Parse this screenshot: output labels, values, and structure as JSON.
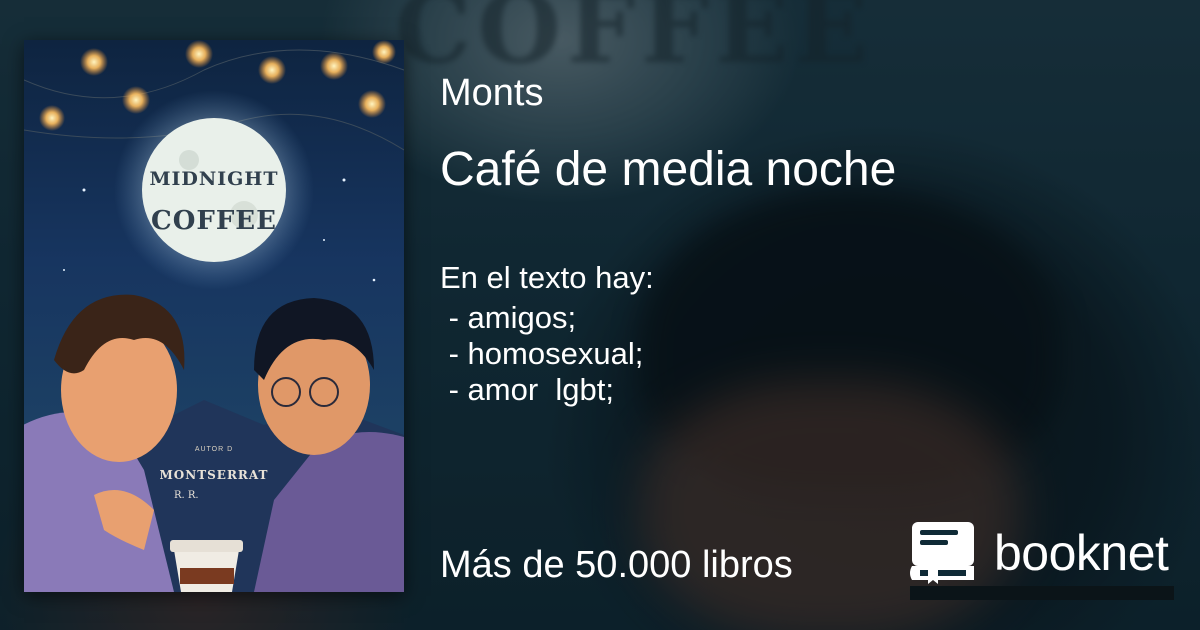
{
  "book": {
    "author": "Monts",
    "title": "Café de media noche",
    "tags_heading": "En el texto hay:",
    "tags": [
      " - amigos;",
      " - homosexual;",
      " - amor  lgbt;"
    ]
  },
  "cover": {
    "title_line1": "MIDNIGHT",
    "title_line2": "COFFEE",
    "small_text": "AUTOR D",
    "author_line1": "MONTSERRAT",
    "author_line2": "R. R."
  },
  "footer": {
    "tagline": "Más de 50.000 libros"
  },
  "brand": {
    "name": "booknet",
    "icon": "book-icon"
  },
  "background": {
    "word": "COFFEE"
  },
  "colors": {
    "text": "#ffffff",
    "background": "#0f2a36"
  }
}
